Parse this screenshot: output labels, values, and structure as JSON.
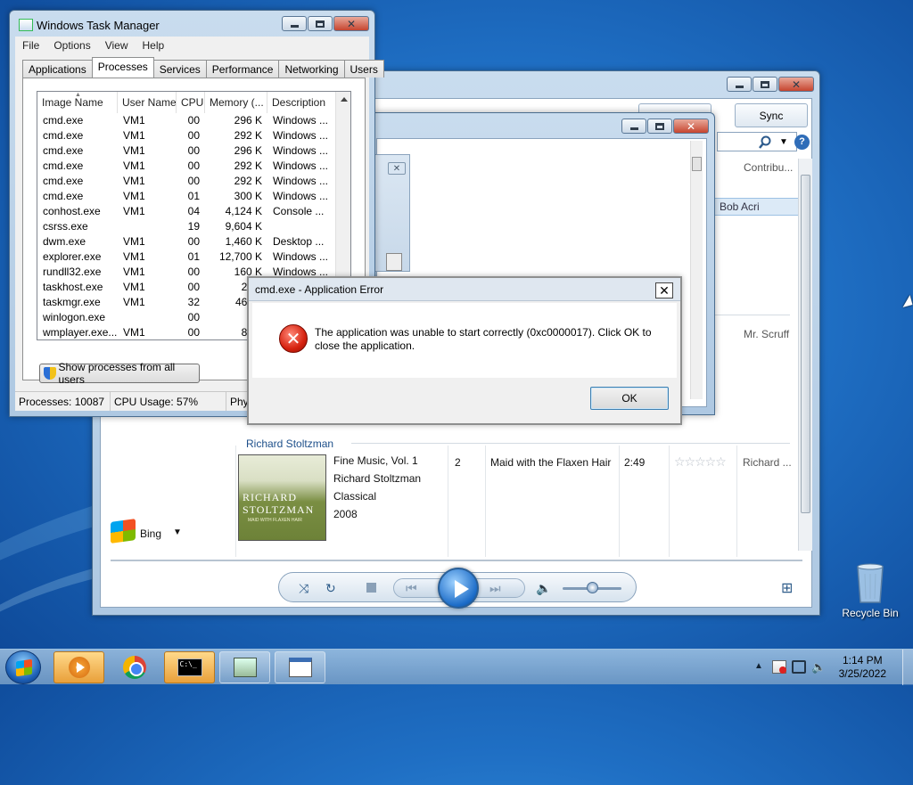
{
  "desktop": {
    "recycle_bin_label": "Recycle Bin"
  },
  "media_player": {
    "sync_tab": "Sync",
    "column_contributing": "Contribu...",
    "highlight_artist": "Bob Acri",
    "artist_2": "Mr. Scruff",
    "group_header": "Richard Stoltzman",
    "album_art_line1": "RICHARD",
    "album_art_line2": "STOLTZMAN",
    "album_art_line3": "MAID WITH FLAXEN HAIR",
    "album_title": "Fine Music, Vol. 1",
    "album_artist": "Richard Stoltzman",
    "genre": "Classical",
    "year": "2008",
    "track_number": "2",
    "track_title": "Maid with the Flaxen Hair",
    "track_length": "2:49",
    "contributing_artist": "Richard ...",
    "rating_stars": "☆☆☆☆☆",
    "bing_label": "Bing",
    "volume_level": 0.5
  },
  "task_manager": {
    "title": "Windows Task Manager",
    "menu": [
      "File",
      "Options",
      "View",
      "Help"
    ],
    "tabs": [
      "Applications",
      "Processes",
      "Services",
      "Performance",
      "Networking",
      "Users"
    ],
    "active_tab": "Processes",
    "columns": [
      "Image Name",
      "User Name",
      "CPU",
      "Memory (...",
      "Description"
    ],
    "processes": [
      {
        "name": "cmd.exe",
        "user": "VM1",
        "cpu": "00",
        "mem": "296 K",
        "desc": "Windows ..."
      },
      {
        "name": "cmd.exe",
        "user": "VM1",
        "cpu": "00",
        "mem": "292 K",
        "desc": "Windows ..."
      },
      {
        "name": "cmd.exe",
        "user": "VM1",
        "cpu": "00",
        "mem": "296 K",
        "desc": "Windows ..."
      },
      {
        "name": "cmd.exe",
        "user": "VM1",
        "cpu": "00",
        "mem": "292 K",
        "desc": "Windows ..."
      },
      {
        "name": "cmd.exe",
        "user": "VM1",
        "cpu": "00",
        "mem": "292 K",
        "desc": "Windows ..."
      },
      {
        "name": "cmd.exe",
        "user": "VM1",
        "cpu": "01",
        "mem": "300 K",
        "desc": "Windows ..."
      },
      {
        "name": "conhost.exe",
        "user": "VM1",
        "cpu": "04",
        "mem": "4,124 K",
        "desc": "Console ..."
      },
      {
        "name": "csrss.exe",
        "user": "",
        "cpu": "19",
        "mem": "9,604 K",
        "desc": ""
      },
      {
        "name": "dwm.exe",
        "user": "VM1",
        "cpu": "00",
        "mem": "1,460 K",
        "desc": "Desktop ..."
      },
      {
        "name": "explorer.exe",
        "user": "VM1",
        "cpu": "01",
        "mem": "12,700 K",
        "desc": "Windows ..."
      },
      {
        "name": "rundll32.exe",
        "user": "VM1",
        "cpu": "00",
        "mem": "160 K",
        "desc": "Windows ..."
      },
      {
        "name": "taskhost.exe",
        "user": "VM1",
        "cpu": "00",
        "mem": "2,42",
        "desc": ""
      },
      {
        "name": "taskmgr.exe",
        "user": "VM1",
        "cpu": "32",
        "mem": "46,50",
        "desc": ""
      },
      {
        "name": "winlogon.exe",
        "user": "",
        "cpu": "00",
        "mem": "73",
        "desc": ""
      },
      {
        "name": "wmplayer.exe...",
        "user": "VM1",
        "cpu": "00",
        "mem": "8,76",
        "desc": ""
      }
    ],
    "show_all_button": "Show processes from all users",
    "status": {
      "processes": "Processes: 10087",
      "cpu": "CPU Usage: 57%",
      "phys": "Phy"
    }
  },
  "error_dialog": {
    "title": "cmd.exe - Application Error",
    "message": "The application was unable to start correctly (0xc0000017). Click OK to close the application.",
    "ok_label": "OK",
    "close_glyph": "✕"
  },
  "taskbar": {
    "cmd_icon_text": "C:\\_",
    "time": "1:14 PM",
    "date": "3/25/2022",
    "tray_chevron": "▲"
  }
}
